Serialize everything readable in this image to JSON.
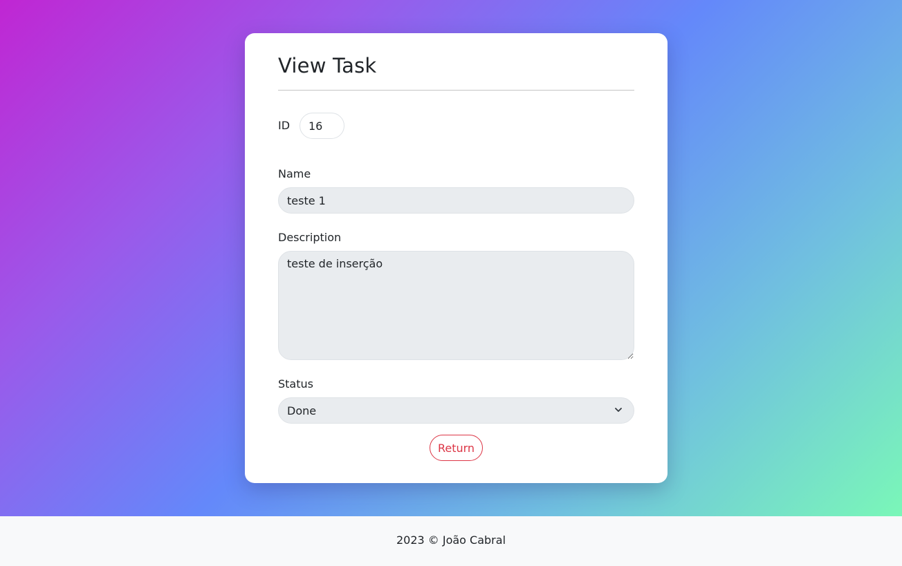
{
  "card": {
    "title": "View Task"
  },
  "form": {
    "id_label": "ID",
    "id_value": "16",
    "name_label": "Name",
    "name_value": "teste 1",
    "description_label": "Description",
    "description_value": "teste de inserção",
    "status_label": "Status",
    "status_value": "Done",
    "return_label": "Return"
  },
  "footer": {
    "text": "2023 © João Cabral"
  },
  "colors": {
    "danger": "#dc3545",
    "input_bg": "#e9ecef",
    "footer_bg": "#f8f9fa"
  }
}
